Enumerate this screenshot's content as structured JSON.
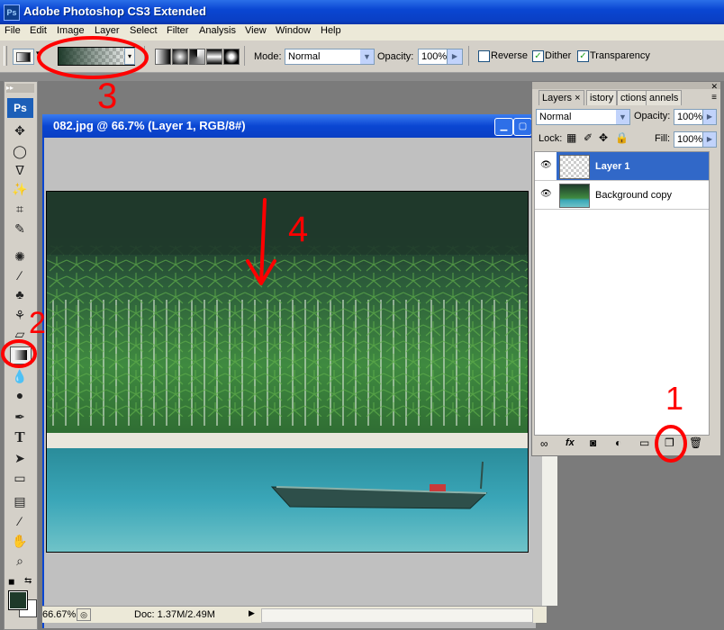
{
  "window": {
    "app_icon": "Ps",
    "title": "Adobe Photoshop CS3 Extended"
  },
  "menu": [
    "File",
    "Edit",
    "Image",
    "Layer",
    "Select",
    "Filter",
    "Analysis",
    "View",
    "Window",
    "Help"
  ],
  "options_bar": {
    "mode_label": "Mode:",
    "mode_value": "Normal",
    "opacity_label": "Opacity:",
    "opacity_value": "100%",
    "reverse_label": "Reverse",
    "reverse_checked": false,
    "dither_label": "Dither",
    "dither_checked": true,
    "transparency_label": "Transparency",
    "transparency_checked": true
  },
  "toolbox": {
    "logo": "Ps",
    "tools": [
      "move-tool",
      "marquee-tool",
      "lasso-tool",
      "magic-wand-tool",
      "crop-tool",
      "eyedropper-tool",
      "healing-brush-tool",
      "brush-tool",
      "clone-stamp-tool",
      "history-brush-tool",
      "eraser-tool",
      "gradient-tool",
      "blur-tool",
      "dodge-tool",
      "pen-tool",
      "type-tool",
      "path-selection-tool",
      "shape-tool",
      "notes-tool",
      "eyedropper2-tool",
      "hand-tool",
      "zoom-tool"
    ],
    "type_glyph": "T",
    "foreground_color": "#1e3a2a",
    "background_color": "#ffffff"
  },
  "document": {
    "title": "082.jpg @ 66.7% (Layer 1, RGB/8#)",
    "zoom": "66.67%",
    "doc_size": "Doc: 1.37M/2.49M"
  },
  "layers_panel": {
    "tabs": [
      "Layers",
      "istory",
      "ctions",
      "annels"
    ],
    "blend_mode": "Normal",
    "opacity_label": "Opacity:",
    "opacity_value": "100%",
    "lock_label": "Lock:",
    "fill_label": "Fill:",
    "fill_value": "100%",
    "layers": [
      {
        "name": "Layer 1",
        "selected": true
      },
      {
        "name": "Background copy",
        "selected": false
      }
    ],
    "fx_label": "fx"
  },
  "annotations": [
    "1",
    "2",
    "3",
    "4"
  ],
  "colors": {
    "accent": "#0a46d2",
    "annotation_red": "#ff0000",
    "selection": "#3168c8"
  }
}
